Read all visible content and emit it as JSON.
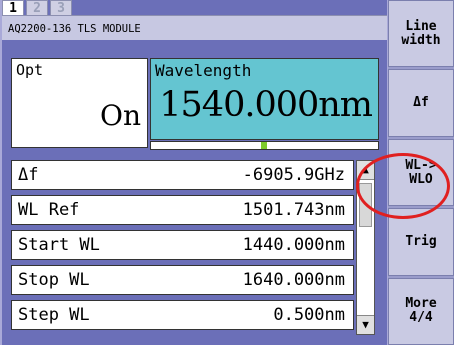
{
  "tabs": [
    "1",
    "2",
    "3"
  ],
  "active_tab": 0,
  "module": "AQ2200-136 TLS MODULE",
  "opt": {
    "label": "Opt",
    "value": "On"
  },
  "wavelength": {
    "label": "Wavelength",
    "value": "1540.000nm"
  },
  "rows": [
    {
      "label": "Δf",
      "value": "-6905.9GHz"
    },
    {
      "label": "WL Ref",
      "value": "1501.743nm"
    },
    {
      "label": "Start WL",
      "value": "1440.000nm"
    },
    {
      "label": "Stop WL",
      "value": "1640.000nm"
    },
    {
      "label": "Step WL",
      "value": "0.500nm"
    }
  ],
  "softkeys": [
    "Line\nwidth",
    "Δf",
    "WL->\nWLO",
    "Trig",
    "More\n4/4"
  ],
  "colors": {
    "wavelength_panel": "#64c5d1",
    "background": "#6b6fb8",
    "highlight_circle": "#e02020",
    "indicator": "#7ecb2d"
  },
  "icons": {
    "scroll_up": "triangle-up",
    "scroll_down": "triangle-down"
  }
}
